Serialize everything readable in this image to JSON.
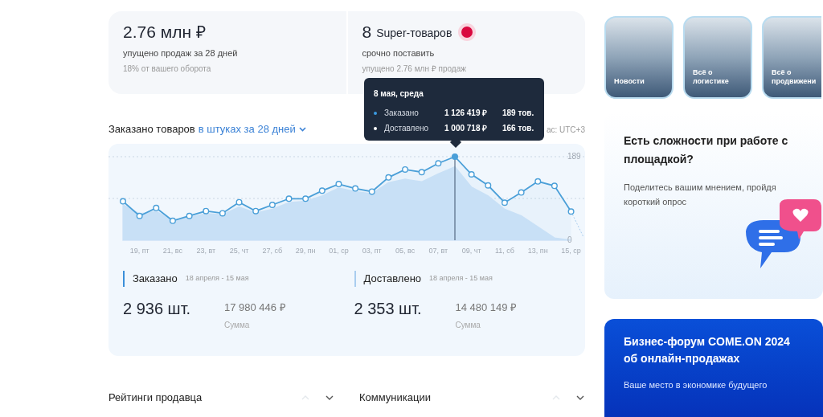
{
  "summary_cards": [
    {
      "value": "2.76 млн ₽",
      "caption": "упущено продаж за 28 дней",
      "note": "18% от вашего оборота",
      "alert": false
    },
    {
      "value": "8",
      "suffix": "Super-товаров",
      "caption": "срочно поставить",
      "note": "упущено 2.76 млн ₽ продаж",
      "alert": true
    }
  ],
  "orders_chart": {
    "title": "Заказано товаров",
    "filter": "в штуках за 28 дней",
    "timezone": "ас: UTC+3",
    "tooltip": {
      "title": "8 мая, среда",
      "rows": [
        {
          "amount": "1 126 419 ₽",
          "count": "189 тов.",
          "color": "#3b9ae1"
        },
        {
          "amount": "1 000 718 ₽",
          "count": "166 тов.",
          "color": "#ffffff"
        }
      ]
    },
    "chart_data": {
      "type": "area",
      "ref_lines": [
        {
          "axis": "y",
          "value": 94.5
        }
      ],
      "categories": [
        null,
        "19, пт",
        null,
        "21, вс",
        null,
        "23, вт",
        null,
        "25, чт",
        null,
        "27, сб",
        null,
        "29, пн",
        null,
        "01, ср",
        null,
        "03, пт",
        null,
        "05, вс",
        null,
        "07, вт",
        null,
        "09, чт",
        null,
        "11, сб",
        null,
        "13, пн",
        null,
        "15, ср"
      ],
      "ylim": [
        0,
        189
      ],
      "yticks": [
        0,
        189
      ],
      "series": [
        {
          "name": "Заказано",
          "color": "#4a9fd8",
          "values": [
            88,
            55,
            73,
            44,
            55,
            66,
            61,
            86,
            66,
            80,
            94,
            94,
            112,
            127,
            117,
            110,
            142,
            160,
            154,
            174,
            189,
            149,
            124,
            85,
            108,
            133,
            123,
            65
          ]
        },
        {
          "name": "Доставлено",
          "color": "#cfe4f8",
          "values": [
            80,
            60,
            65,
            45,
            52,
            60,
            58,
            75,
            62,
            70,
            85,
            88,
            100,
            118,
            110,
            105,
            130,
            138,
            132,
            150,
            166,
            120,
            100,
            70,
            55,
            30,
            5,
            0
          ]
        }
      ]
    }
  },
  "totals": [
    {
      "label": "Заказано",
      "period": "18 апреля - 15 мая",
      "count": "2 936 шт.",
      "sum": "17 980 446 ₽",
      "sum_label": "Сумма",
      "color": "#3b8fd9"
    },
    {
      "label": "Доставлено",
      "period": "18 апреля - 15 мая",
      "count": "2 353 шт.",
      "sum": "14 480 149 ₽",
      "sum_label": "Сумма",
      "color": "#a9cdef"
    }
  ],
  "sections": [
    {
      "title": "Рейтинги продавца",
      "expanded": false
    },
    {
      "title": "Коммуникации",
      "expanded": false
    }
  ],
  "news_tiles": [
    {
      "label": "Новости"
    },
    {
      "label": "Всё о логистике"
    },
    {
      "label": "Всё о продвижени"
    }
  ],
  "survey_card": {
    "title": "Есть сложности при работе с площадкой?",
    "text": "Поделитесь вашим мнением, пройдя короткий опрос"
  },
  "forum_card": {
    "title": "Бизнес-форум COME.ON 2024 об онлайн-продажах",
    "text": "Ваше место в экономике будущего"
  }
}
